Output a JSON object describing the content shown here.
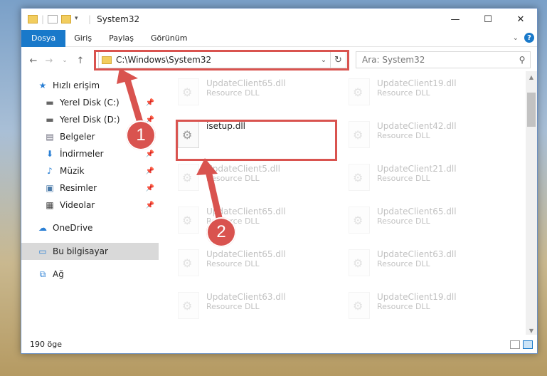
{
  "window": {
    "title": "System32",
    "minimize": "—",
    "maximize": "☐",
    "close": "✕"
  },
  "ribbon": {
    "tabs": [
      "Dosya",
      "Giriş",
      "Paylaş",
      "Görünüm"
    ],
    "help": "?"
  },
  "nav": {
    "back": "←",
    "forward": "→",
    "up": "↑",
    "recent": "⌄"
  },
  "address": {
    "path": "C:\\Windows\\System32",
    "dropdown": "⌄",
    "refresh": "↻"
  },
  "search": {
    "placeholder": "Ara: System32",
    "icon": "⚲"
  },
  "sidebar": {
    "items": [
      {
        "label": "Hızlı erişim",
        "icon": "star-icon",
        "pinned": false
      },
      {
        "label": "Yerel Disk (C:)",
        "icon": "drive-icon",
        "pinned": true
      },
      {
        "label": "Yerel Disk (D:)",
        "icon": "drive-icon",
        "pinned": true
      },
      {
        "label": "Belgeler",
        "icon": "document-icon",
        "pinned": true
      },
      {
        "label": "İndirmeler",
        "icon": "download-icon",
        "pinned": true
      },
      {
        "label": "Müzik",
        "icon": "music-icon",
        "pinned": true
      },
      {
        "label": "Resimler",
        "icon": "picture-icon",
        "pinned": true
      },
      {
        "label": "Videolar",
        "icon": "video-icon",
        "pinned": true
      },
      {
        "label": "OneDrive",
        "icon": "cloud-icon",
        "pinned": false
      },
      {
        "label": "Bu bilgisayar",
        "icon": "computer-icon",
        "pinned": false,
        "selected": true
      },
      {
        "label": "Ağ",
        "icon": "network-icon",
        "pinned": false
      }
    ]
  },
  "files": {
    "left": [
      {
        "name": "UpdateClient65.dll",
        "type": "Resource DLL"
      },
      {
        "name": "isetup.dll",
        "type": ""
      },
      {
        "name": "UpdateClient5.dll",
        "type": "Resource DLL"
      },
      {
        "name": "UpdateClient65.dll",
        "type": "Resource DLL"
      },
      {
        "name": "UpdateClient65.dll",
        "type": "Resource DLL"
      },
      {
        "name": "UpdateClient63.dll",
        "type": "Resource DLL"
      }
    ],
    "right": [
      {
        "name": "UpdateClient19.dll",
        "type": "Resource DLL"
      },
      {
        "name": "UpdateClient42.dll",
        "type": "Resource DLL"
      },
      {
        "name": "UpdateClient21.dll",
        "type": "Resource DLL"
      },
      {
        "name": "UpdateClient65.dll",
        "type": "Resource DLL"
      },
      {
        "name": "UpdateClient63.dll",
        "type": "Resource DLL"
      },
      {
        "name": "UpdateClient19.dll",
        "type": "Resource DLL"
      }
    ]
  },
  "annotations": {
    "step1": "1",
    "step2": "2",
    "color": "#d9534f"
  },
  "status": {
    "count": "190 öge"
  }
}
